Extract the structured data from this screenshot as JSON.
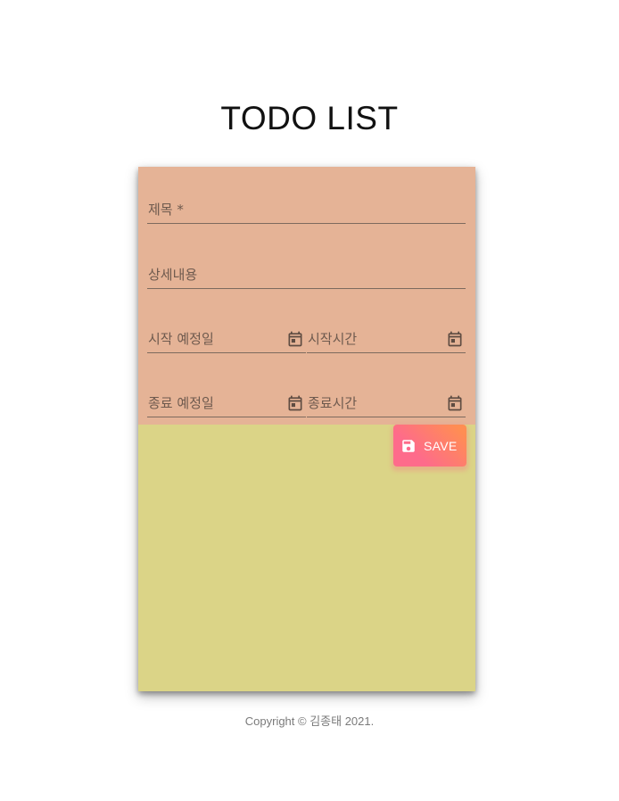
{
  "header": {
    "title": "TODO LIST"
  },
  "form": {
    "title_label": "제목 *",
    "detail_label": "상세내용",
    "start_date_label": "시작 예정일",
    "start_time_label": "시작시간",
    "end_date_label": "종료 예정일",
    "end_time_label": "종료시간",
    "calendar_icon": "calendar-icon"
  },
  "actions": {
    "save_label": "SAVE",
    "save_icon": "save-icon"
  },
  "footer": {
    "copyright": "Copyright © 김종태 2021."
  },
  "colors": {
    "form_background": "#e5b396",
    "list_background": "#dbd487",
    "save_gradient_start": "#fe6b8b",
    "save_gradient_end": "#ff8e53"
  }
}
